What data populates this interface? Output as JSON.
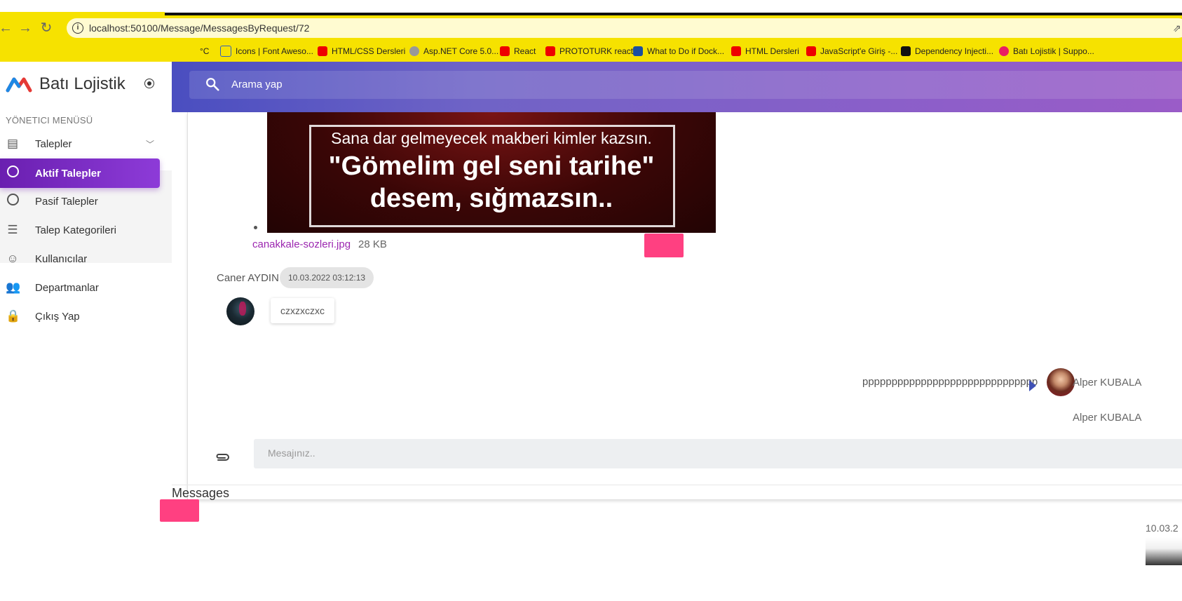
{
  "browser": {
    "url": "localhost:50100/Message/MessagesByRequest/72",
    "bookmarks": [
      {
        "label": "°C"
      },
      {
        "label": "Icons | Font Aweso..."
      },
      {
        "label": "HTML/CSS Dersleri"
      },
      {
        "label": "Asp.NET Core 5.0..."
      },
      {
        "label": "React"
      },
      {
        "label": "PROTOTURK react"
      },
      {
        "label": "What to Do if Dock..."
      },
      {
        "label": "HTML Dersleri"
      },
      {
        "label": "JavaScript'e Giriş -..."
      },
      {
        "label": "Dependency Injecti..."
      },
      {
        "label": "Batı Lojistik | Suppo..."
      }
    ]
  },
  "sidebar": {
    "brand": "Batı Lojistik",
    "section_title": "YÖNETICI MENÜSÜ",
    "items": [
      {
        "label": "Talepler",
        "icon": "list-alt-icon"
      },
      {
        "label": "Aktif Talepler",
        "icon": "circle-icon",
        "active": true
      },
      {
        "label": "Pasif Talepler",
        "icon": "circle-icon"
      },
      {
        "label": "Talep Kategorileri",
        "icon": "list-icon"
      },
      {
        "label": "Kullanıcılar",
        "icon": "face-icon"
      },
      {
        "label": "Departmanlar",
        "icon": "people-icon"
      },
      {
        "label": "Çıkış Yap",
        "icon": "lock-icon"
      }
    ]
  },
  "header": {
    "search_placeholder": "Arama yap"
  },
  "chat": {
    "image": {
      "line1": "Sana dar gelmeyecek makberi kimler kazsın.",
      "line2": "\"Gömelim gel seni tarihe\"",
      "line3": "desem, sığmazsın.."
    },
    "attachment": {
      "filename": "canakkale-sozleri.jpg",
      "size": "28 KB"
    },
    "incoming": {
      "sender": "Caner AYDIN",
      "timestamp": "10.03.2022 03:12:13",
      "text": "czxzxczxc"
    },
    "outgoing": {
      "text": "pppppppppppppppppppppppppppppp",
      "sender": "Alper KUBALA",
      "sender_repeat": "Alper KUBALA"
    },
    "input_placeholder": "Mesajınız.."
  },
  "messages_section": {
    "title": "Messages",
    "date": "10.03.2"
  },
  "colors": {
    "accent": "#7b2fc9",
    "pink": "#ff4081",
    "blue": "#3f51b5",
    "browser_yellow": "#f6e200"
  }
}
